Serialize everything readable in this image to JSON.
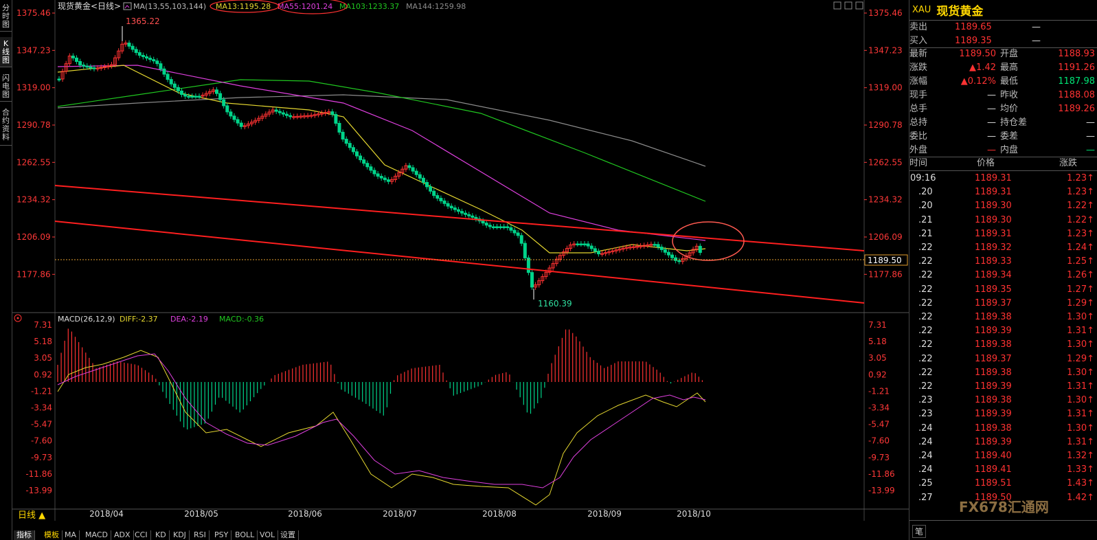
{
  "sidebar_tabs": [
    "分时图",
    "K线图",
    "闪电图",
    "合约资料"
  ],
  "chart": {
    "title": "现货黄金<日线>",
    "ma_prefix": "MA(13,55,103,144)",
    "ma13": "MA13:1195.28",
    "ma55": "MA55:1201.24",
    "ma103": "MA103:1233.37",
    "ma144": "MA144:1259.98",
    "y_ticks": [
      "1375.46",
      "1347.23",
      "1319.00",
      "1290.78",
      "1262.55",
      "1234.32",
      "1206.09",
      "1177.86"
    ],
    "x_ticks": [
      "2018/04",
      "2018/05",
      "2018/06",
      "2018/07",
      "2018/08",
      "2018/09",
      "2018/10"
    ],
    "high_label": "1365.22",
    "low_label": "1160.39",
    "last_price_label": "1189.50",
    "period_label": "日线",
    "colors": {
      "up": "#ff3232",
      "down": "#00d48a",
      "ma13": "#e6d830",
      "ma55": "#e040e0",
      "ma103": "#20c820",
      "ma144": "#8c8c8c",
      "trend": "#ff1f1f"
    }
  },
  "macd": {
    "title": "MACD(26,12,9)",
    "diff": "DIFF:-2.37",
    "dea": "DEA:-2.19",
    "macd": "MACD:-0.36",
    "y_ticks": [
      "7.31",
      "5.18",
      "3.05",
      "0.92",
      "-1.21",
      "-3.34",
      "-5.47",
      "-7.60",
      "-9.73",
      "-11.86",
      "-13.99"
    ]
  },
  "bottom_tabs": [
    "指标",
    "模板",
    "MA",
    "MACD",
    "ADX",
    "CCI",
    "KD",
    "KDJ",
    "RSI",
    "PSY",
    "BOLL",
    "VOL",
    "设置"
  ],
  "quote": {
    "symbol": "XAU",
    "name": "现货黄金",
    "sell_label": "卖出",
    "sell": "1189.65",
    "sell_vol": "—",
    "buy_label": "买入",
    "buy": "1189.35",
    "buy_vol": "—",
    "fields": [
      {
        "l1": "最新",
        "v1": "1189.50",
        "l2": "开盘",
        "v2": "1188.93"
      },
      {
        "l1": "涨跌",
        "v1": "▲1.42",
        "l2": "最高",
        "v2": "1191.26"
      },
      {
        "l1": "涨幅",
        "v1": "▲0.12%",
        "l2": "最低",
        "v2": "1187.98"
      },
      {
        "l1": "现手",
        "v1": "—",
        "l2": "昨收",
        "v2": "1188.08"
      },
      {
        "l1": "总手",
        "v1": "—",
        "l2": "均价",
        "v2": "1189.26"
      },
      {
        "l1": "总持",
        "v1": "—",
        "l2": "持仓差",
        "v2": "—"
      },
      {
        "l1": "委比",
        "v1": "—",
        "l2": "委差",
        "v2": "—"
      },
      {
        "l1": "外盘",
        "v1": "—",
        "l2": "内盘",
        "v2": "—"
      }
    ],
    "ticks_header": [
      "时间",
      "价格",
      "涨跌"
    ],
    "ticks": [
      [
        "09:16",
        "1189.31",
        "1.23↑"
      ],
      [
        ".20",
        "1189.31",
        "1.23↑"
      ],
      [
        ".20",
        "1189.30",
        "1.22↑"
      ],
      [
        ".21",
        "1189.30",
        "1.22↑"
      ],
      [
        ".21",
        "1189.31",
        "1.23↑"
      ],
      [
        ".22",
        "1189.32",
        "1.24↑"
      ],
      [
        ".22",
        "1189.33",
        "1.25↑"
      ],
      [
        ".22",
        "1189.34",
        "1.26↑"
      ],
      [
        ".22",
        "1189.35",
        "1.27↑"
      ],
      [
        ".22",
        "1189.37",
        "1.29↑"
      ],
      [
        ".22",
        "1189.38",
        "1.30↑"
      ],
      [
        ".22",
        "1189.39",
        "1.31↑"
      ],
      [
        ".22",
        "1189.38",
        "1.30↑"
      ],
      [
        ".22",
        "1189.37",
        "1.29↑"
      ],
      [
        ".22",
        "1189.38",
        "1.30↑"
      ],
      [
        ".22",
        "1189.39",
        "1.31↑"
      ],
      [
        ".23",
        "1189.38",
        "1.30↑"
      ],
      [
        ".23",
        "1189.39",
        "1.31↑"
      ],
      [
        ".24",
        "1189.38",
        "1.30↑"
      ],
      [
        ".24",
        "1189.39",
        "1.31↑"
      ],
      [
        ".24",
        "1189.40",
        "1.32↑"
      ],
      [
        ".24",
        "1189.41",
        "1.33↑"
      ],
      [
        ".25",
        "1189.51",
        "1.43↑"
      ],
      [
        ".27",
        "1189.50",
        "1.42↑"
      ]
    ],
    "footer_tab": "笔",
    "watermark": "FX678汇通网"
  }
}
